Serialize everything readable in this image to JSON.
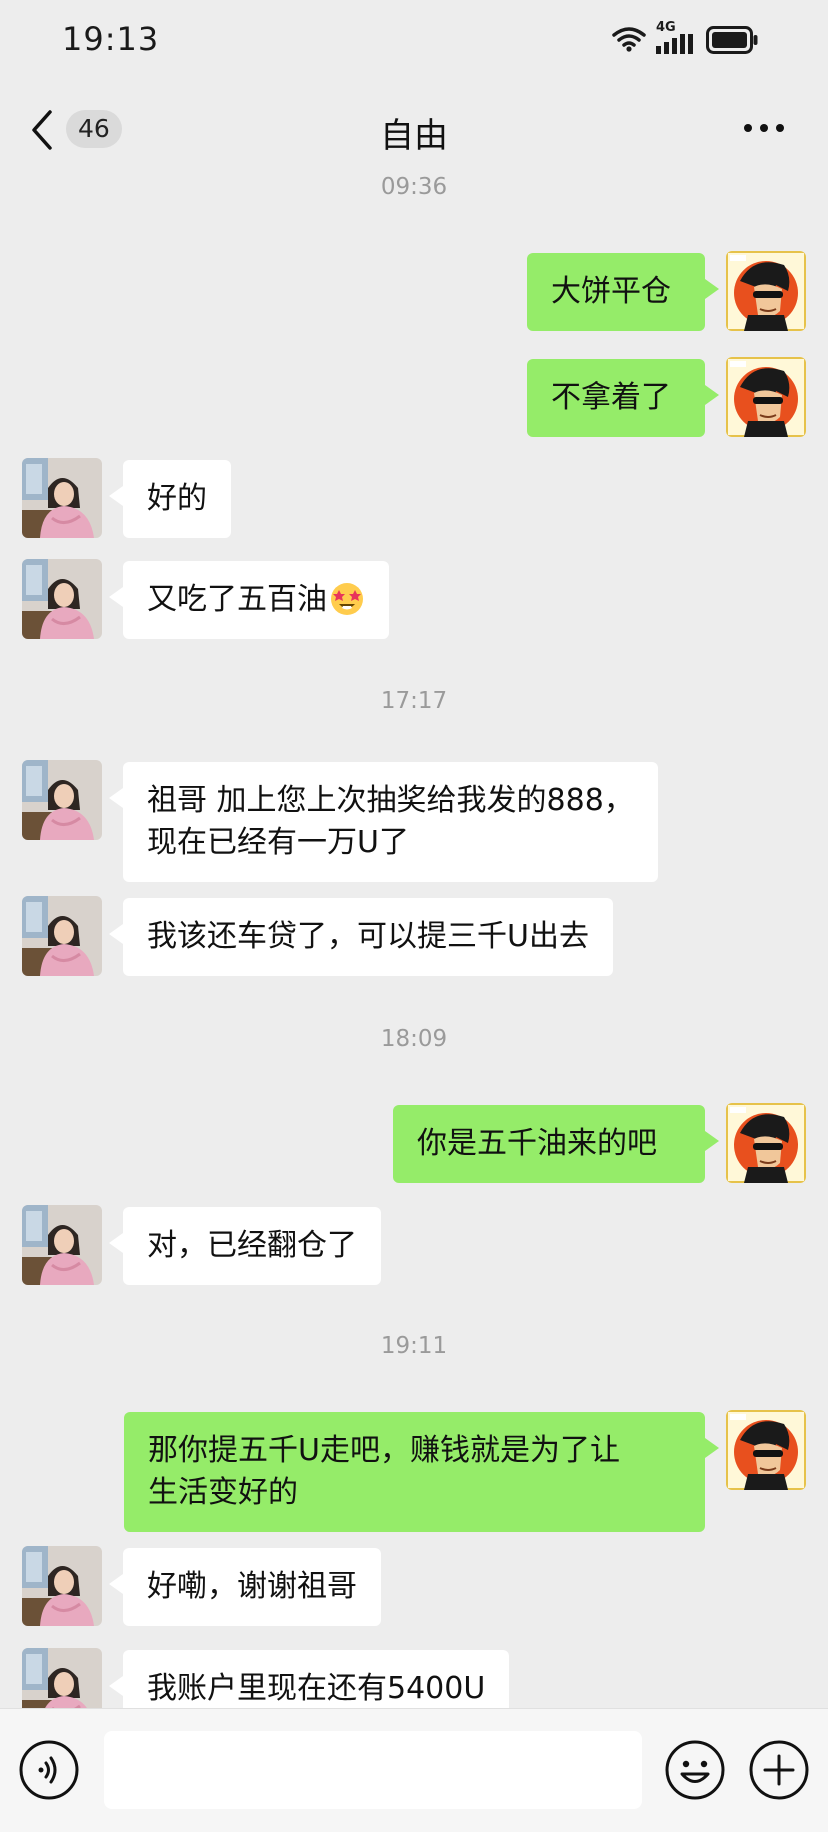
{
  "status_bar": {
    "time": "19:13",
    "network": "4G"
  },
  "header": {
    "back_label": "back",
    "unread_count": "46",
    "title": "自由",
    "more_label": "more"
  },
  "messages": [
    {
      "kind": "timestamp",
      "text": "09:36"
    },
    {
      "kind": "msg",
      "side": "right",
      "text": "大饼平仓"
    },
    {
      "kind": "msg",
      "side": "right",
      "text": "不拿着了"
    },
    {
      "kind": "msg",
      "side": "left",
      "text": "好的"
    },
    {
      "kind": "msg",
      "side": "left",
      "text": "又吃了五百油",
      "emoji": "star-struck-emoji"
    },
    {
      "kind": "timestamp",
      "text": "17:17"
    },
    {
      "kind": "msg",
      "side": "left",
      "text": "祖哥 加上您上次抽奖给我发的888，\n现在已经有一万U了"
    },
    {
      "kind": "msg",
      "side": "left",
      "text": "我该还车贷了，可以提三千U出去"
    },
    {
      "kind": "timestamp",
      "text": "18:09"
    },
    {
      "kind": "msg",
      "side": "right",
      "text": "你是五千油来的吧"
    },
    {
      "kind": "msg",
      "side": "left",
      "text": "对，已经翻仓了"
    },
    {
      "kind": "timestamp",
      "text": "19:11"
    },
    {
      "kind": "msg",
      "side": "right",
      "text": "那你提五千U走吧，赚钱就是为了让\n生活变好的"
    },
    {
      "kind": "msg",
      "side": "left",
      "text": "好嘞，谢谢祖哥"
    },
    {
      "kind": "msg",
      "side": "left",
      "text": "我账户里现在还有5400U"
    }
  ],
  "input_bar": {
    "placeholder": "",
    "voice_icon": "voice-icon",
    "emoji_icon": "emoji-icon",
    "plus_icon": "plus-icon"
  },
  "colors": {
    "background": "#ededed",
    "sent_bubble": "#95ec69",
    "received_bubble": "#ffffff",
    "timestamp": "#9a9a9a"
  }
}
